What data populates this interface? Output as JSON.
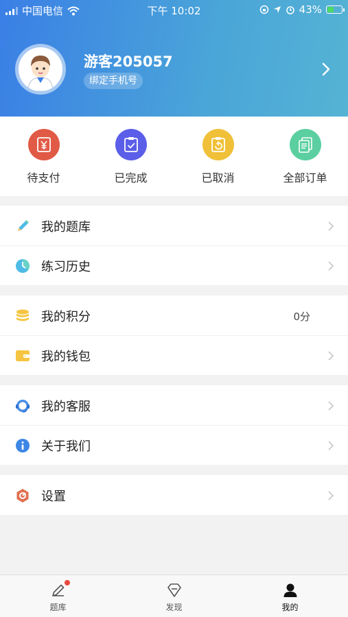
{
  "status_bar": {
    "carrier": "中国电信",
    "time": "下午 10:02",
    "battery": "43%",
    "battery_level": 0.43
  },
  "profile": {
    "username": "游客205057",
    "bind_phone": "绑定手机号"
  },
  "orders": [
    {
      "label": "待支付",
      "icon": "yuan-icon",
      "color": "#e05a45"
    },
    {
      "label": "已完成",
      "icon": "check-clipboard-icon",
      "color": "#5b5ee8"
    },
    {
      "label": "已取消",
      "icon": "cancel-clipboard-icon",
      "color": "#f0c038"
    },
    {
      "label": "全部订单",
      "icon": "document-stack-icon",
      "color": "#5bcfa0"
    }
  ],
  "menu": {
    "question_bank": {
      "label": "我的题库",
      "icon": "pencil-icon"
    },
    "history": {
      "label": "练习历史",
      "icon": "clock-icon"
    },
    "points": {
      "label": "我的积分",
      "value": "0分",
      "icon": "coins-icon"
    },
    "wallet": {
      "label": "我的钱包",
      "icon": "wallet-icon"
    },
    "support": {
      "label": "我的客服",
      "icon": "headset-icon"
    },
    "about": {
      "label": "关于我们",
      "icon": "info-icon"
    },
    "settings": {
      "label": "设置",
      "icon": "gear-icon"
    }
  },
  "tabbar": [
    {
      "label": "题库",
      "icon": "pencil-icon",
      "badge": true
    },
    {
      "label": "发现",
      "icon": "diamond-icon"
    },
    {
      "label": "我的",
      "icon": "person-icon",
      "active": true
    }
  ],
  "colors": {
    "header_start": "#3a7fe6",
    "header_end": "#55b3d4",
    "badge_red": "#e84a3c"
  }
}
